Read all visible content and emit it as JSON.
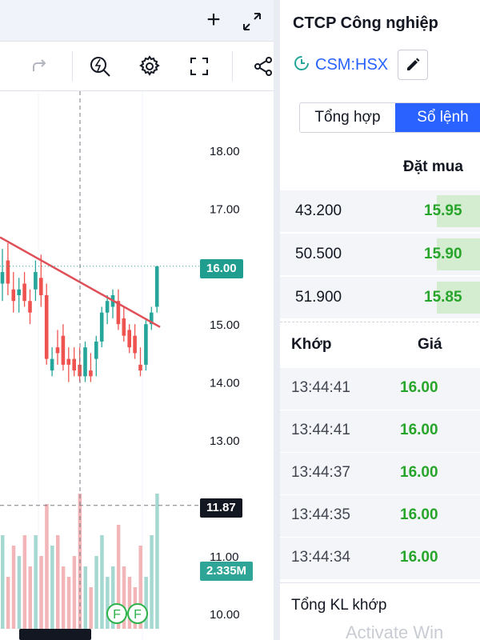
{
  "chart": {
    "price_labels": [
      "18.00",
      "17.00",
      "15.00",
      "14.00",
      "13.00",
      "11.00",
      "10.00"
    ],
    "last_price": "16.00",
    "crosshair_price": "11.87",
    "volume_tag": "2.335M",
    "marker_labels": [
      "F",
      "F"
    ],
    "colors": {
      "up": "#26a69a",
      "down": "#ef5350",
      "trendline": "#e04f57"
    },
    "toolbar_icons": [
      "redo-icon",
      "alert-icon",
      "settings-icon",
      "fullscreen-icon",
      "share-icon"
    ]
  },
  "chart_data": {
    "type": "candlestick",
    "ylim": [
      9.8,
      18.6
    ],
    "series": [
      {
        "o": 15.7,
        "h": 16.3,
        "l": 15.4,
        "c": 15.9
      },
      {
        "o": 16.1,
        "h": 16.4,
        "l": 15.5,
        "c": 15.7
      },
      {
        "o": 15.6,
        "h": 15.9,
        "l": 15.2,
        "c": 15.4
      },
      {
        "o": 15.5,
        "h": 15.8,
        "l": 15.2,
        "c": 15.6
      },
      {
        "o": 15.7,
        "h": 15.9,
        "l": 15.3,
        "c": 15.4
      },
      {
        "o": 15.4,
        "h": 15.6,
        "l": 15.0,
        "c": 15.2
      },
      {
        "o": 15.6,
        "h": 16.1,
        "l": 15.4,
        "c": 15.9
      },
      {
        "o": 15.8,
        "h": 16.2,
        "l": 15.3,
        "c": 15.5
      },
      {
        "o": 15.5,
        "h": 15.7,
        "l": 14.3,
        "c": 14.4
      },
      {
        "o": 14.2,
        "h": 14.6,
        "l": 14.1,
        "c": 14.4
      },
      {
        "o": 14.6,
        "h": 14.9,
        "l": 14.3,
        "c": 14.5
      },
      {
        "o": 14.8,
        "h": 15.0,
        "l": 14.2,
        "c": 14.3
      },
      {
        "o": 14.4,
        "h": 14.6,
        "l": 14.0,
        "c": 14.3
      },
      {
        "o": 14.4,
        "h": 14.6,
        "l": 14.1,
        "c": 14.2
      },
      {
        "o": 14.3,
        "h": 14.6,
        "l": 14.0,
        "c": 14.1
      },
      {
        "o": 14.1,
        "h": 14.7,
        "l": 14.0,
        "c": 14.6
      },
      {
        "o": 14.2,
        "h": 14.5,
        "l": 14.0,
        "c": 14.1
      },
      {
        "o": 14.4,
        "h": 14.8,
        "l": 14.1,
        "c": 14.7
      },
      {
        "o": 14.7,
        "h": 15.3,
        "l": 14.6,
        "c": 15.2
      },
      {
        "o": 15.2,
        "h": 15.5,
        "l": 15.0,
        "c": 15.4
      },
      {
        "o": 15.3,
        "h": 15.6,
        "l": 15.1,
        "c": 15.5
      },
      {
        "o": 15.4,
        "h": 15.6,
        "l": 14.9,
        "c": 15.0
      },
      {
        "o": 15.1,
        "h": 15.3,
        "l": 14.7,
        "c": 14.8
      },
      {
        "o": 14.9,
        "h": 15.0,
        "l": 14.5,
        "c": 14.6
      },
      {
        "o": 14.8,
        "h": 15.0,
        "l": 14.4,
        "c": 14.5
      },
      {
        "o": 14.3,
        "h": 14.6,
        "l": 14.1,
        "c": 14.2
      },
      {
        "o": 14.3,
        "h": 15.1,
        "l": 14.2,
        "c": 15.0
      },
      {
        "o": 15.0,
        "h": 15.3,
        "l": 14.9,
        "c": 15.2
      },
      {
        "o": 15.3,
        "h": 16.0,
        "l": 15.2,
        "c": 16.0
      }
    ],
    "volumes": [
      0.9,
      0.5,
      0.8,
      0.7,
      0.9,
      0.6,
      0.9,
      0.7,
      1.2,
      0.8,
      0.9,
      0.6,
      0.5,
      0.7,
      1.3,
      0.6,
      0.4,
      0.7,
      0.9,
      0.5,
      0.6,
      1.0,
      0.6,
      0.5,
      0.4,
      0.8,
      0.5,
      0.9,
      1.3
    ],
    "trendline": [
      [
        0,
        16.5
      ],
      [
        29,
        14.95
      ]
    ]
  },
  "panel": {
    "title": "CTCP Công nghiệp",
    "symbol": "CSM:HSX",
    "tabs": [
      {
        "label": "Tổng hợp",
        "active": false
      },
      {
        "label": "Sổ lệnh",
        "active": true
      }
    ],
    "bid_header": "Đặt mua",
    "bids": [
      {
        "volume": "43.200",
        "price": "15.95",
        "depth": 0.24
      },
      {
        "volume": "50.500",
        "price": "15.90",
        "depth": 0.24
      },
      {
        "volume": "51.900",
        "price": "15.85",
        "depth": 0.24
      }
    ],
    "match_header": {
      "time": "Khớp",
      "price": "Giá"
    },
    "matches": [
      {
        "time": "13:44:41",
        "price": "16.00"
      },
      {
        "time": "13:44:41",
        "price": "16.00"
      },
      {
        "time": "13:44:37",
        "price": "16.00"
      },
      {
        "time": "13:44:35",
        "price": "16.00"
      },
      {
        "time": "13:44:34",
        "price": "16.00"
      }
    ],
    "total_label": "Tổng KL khớp",
    "watermark": "Activate Win"
  }
}
